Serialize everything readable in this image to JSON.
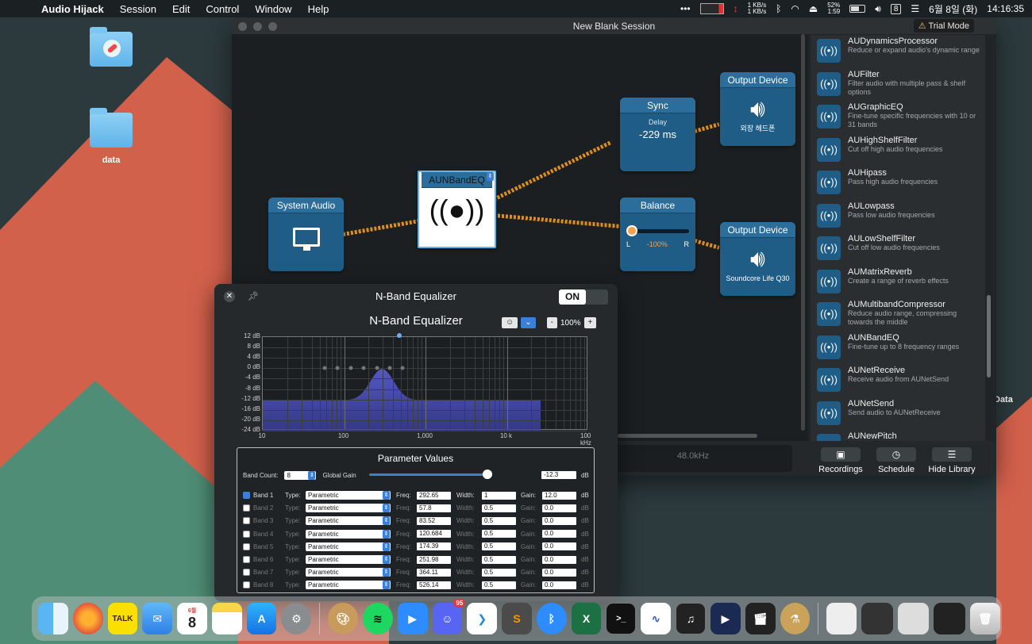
{
  "menubar": {
    "app": "Audio Hijack",
    "items": [
      "Session",
      "Edit",
      "Control",
      "Window",
      "Help"
    ],
    "net_up": "1 KB/s",
    "net_down": "1 KB/s",
    "battery": "52%",
    "battery_time": "1:59",
    "day_box": "8",
    "date": "6월 8일 (화)",
    "time": "14:16:35"
  },
  "desktop": {
    "folder1_label": "",
    "folder2_label": "data",
    "right_label": "Data"
  },
  "window": {
    "title": "New Blank Session",
    "trial": "Trial Mode"
  },
  "blocks": {
    "system_audio": "System Audio",
    "eq": "AUNBandEQ",
    "sync_title": "Sync",
    "sync_label": "Delay",
    "sync_value": "-229 ms",
    "balance_title": "Balance",
    "balance_left": "L",
    "balance_value": "-100%",
    "balance_right": "R",
    "out1_title": "Output Device",
    "out1_name": "외장 헤드폰",
    "out2_title": "Output Device",
    "out2_name": "Soundcore Life Q30"
  },
  "status": {
    "sample_rate": "48.0kHz",
    "recordings": "Recordings",
    "schedule": "Schedule",
    "hide_library": "Hide Library"
  },
  "library": [
    {
      "name": "AUDynamicsProcessor",
      "desc": "Reduce or expand audio's dynamic range"
    },
    {
      "name": "AUFilter",
      "desc": "Filter audio with multiple pass & shelf options"
    },
    {
      "name": "AUGraphicEQ",
      "desc": "Fine-tune specific frequencies with 10 or 31 bands"
    },
    {
      "name": "AUHighShelfFilter",
      "desc": "Cut off high audio frequencies"
    },
    {
      "name": "AUHipass",
      "desc": "Pass high audio frequencies"
    },
    {
      "name": "AULowpass",
      "desc": "Pass low audio frequencies"
    },
    {
      "name": "AULowShelfFilter",
      "desc": "Cut off low audio frequencies"
    },
    {
      "name": "AUMatrixReverb",
      "desc": "Create a range of reverb effects"
    },
    {
      "name": "AUMultibandCompressor",
      "desc": "Reduce audio range, compressing towards the middle"
    },
    {
      "name": "AUNBandEQ",
      "desc": "Fine-tune up to 8 frequency ranges"
    },
    {
      "name": "AUNetReceive",
      "desc": "Receive audio from AUNetSend"
    },
    {
      "name": "AUNetSend",
      "desc": "Send audio to AUNetReceive"
    },
    {
      "name": "AUNewPitch",
      "desc": ""
    }
  ],
  "eq": {
    "window_title": "N-Band Equalizer",
    "on_label": "ON",
    "heading": "N-Band Equalizer",
    "zoom": "100%",
    "minus": "-",
    "plus": "+",
    "y_ticks": [
      "12 dB",
      "8 dB",
      "4 dB",
      "0 dB",
      "-4 dB",
      "-8 dB",
      "-12 dB",
      "-16 dB",
      "-20 dB",
      "-24 dB"
    ],
    "x_ticks": [
      "10",
      "100",
      "1,000",
      "10 k",
      "100 kHz"
    ],
    "params_title": "Parameter Values",
    "band_count_label": "Band Count:",
    "band_count": "8",
    "global_gain_label": "Global Gain",
    "global_gain": "-12.3",
    "db": "dB",
    "type_label": "Type:",
    "freq_label": "Freq:",
    "width_label": "Width:",
    "gain_label": "Gain:",
    "bands": [
      {
        "name": "Band 1",
        "type": "Parametric",
        "freq": "292.65",
        "width": "1",
        "gain": "12.0",
        "on": true
      },
      {
        "name": "Band 2",
        "type": "Parametric",
        "freq": "57.8",
        "width": "0.5",
        "gain": "0.0",
        "on": false
      },
      {
        "name": "Band 3",
        "type": "Parametric",
        "freq": "83.52",
        "width": "0.5",
        "gain": "0.0",
        "on": false
      },
      {
        "name": "Band 4",
        "type": "Parametric",
        "freq": "120.684",
        "width": "0.5",
        "gain": "0.0",
        "on": false
      },
      {
        "name": "Band 5",
        "type": "Parametric",
        "freq": "174.39",
        "width": "0.5",
        "gain": "0.0",
        "on": false
      },
      {
        "name": "Band 6",
        "type": "Parametric",
        "freq": "251.98",
        "width": "0.5",
        "gain": "0.0",
        "on": false
      },
      {
        "name": "Band 7",
        "type": "Parametric",
        "freq": "364.11",
        "width": "0.5",
        "gain": "0.0",
        "on": false
      },
      {
        "name": "Band 8",
        "type": "Parametric",
        "freq": "526.14",
        "width": "0.5",
        "gain": "0.0",
        "on": false
      }
    ]
  },
  "dock": {
    "calendar_month": "6월",
    "calendar_day": "8",
    "discord_badge": "95",
    "talk": "TALK"
  },
  "colors": {
    "block": "#1f5d86",
    "accent": "#3b7fd9",
    "wire": "#f39a1e"
  }
}
